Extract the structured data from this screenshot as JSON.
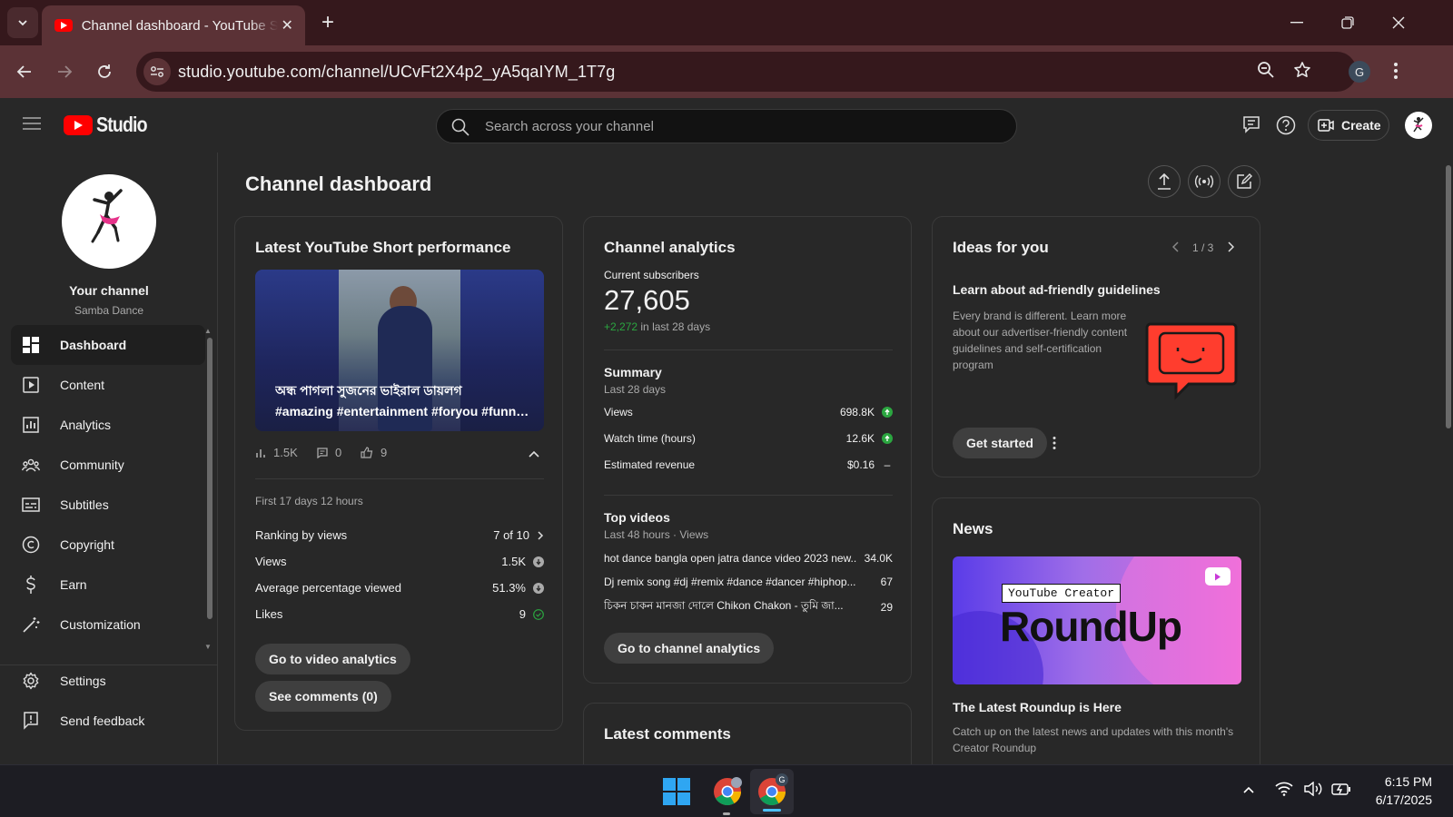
{
  "browser": {
    "tab_title": "Channel dashboard - YouTube Studio",
    "url": "studio.youtube.com/channel/UCvFt2X4p2_yA5qaIYM_1T7g",
    "profile_initial": "G"
  },
  "header": {
    "logo_text": "Studio",
    "search_placeholder": "Search across your channel",
    "create_label": "Create"
  },
  "sidebar": {
    "channel_label": "Your channel",
    "channel_name": "Samba Dance",
    "items": [
      {
        "label": "Dashboard",
        "icon": "dashboard-icon",
        "active": true
      },
      {
        "label": "Content",
        "icon": "content-icon"
      },
      {
        "label": "Analytics",
        "icon": "analytics-icon"
      },
      {
        "label": "Community",
        "icon": "community-icon"
      },
      {
        "label": "Subtitles",
        "icon": "subtitles-icon"
      },
      {
        "label": "Copyright",
        "icon": "copyright-icon"
      },
      {
        "label": "Earn",
        "icon": "earn-icon"
      },
      {
        "label": "Customization",
        "icon": "customization-icon"
      }
    ],
    "bottom_items": [
      {
        "label": "Settings",
        "icon": "gear-icon"
      },
      {
        "label": "Send feedback",
        "icon": "feedback-icon"
      }
    ]
  },
  "main": {
    "title": "Channel dashboard"
  },
  "short_card": {
    "title": "Latest YouTube Short performance",
    "video_title_line1": "অন্ধ পাগলা সুজনের ভাইরাল ডায়লগ",
    "video_title_line2": "#amazing #entertainment #foryou #funny #viral",
    "views_inline": "1.5K",
    "comments_inline": "0",
    "likes_inline": "9",
    "period": "First 17 days 12 hours",
    "stats": [
      {
        "label": "Ranking by views",
        "value": "7 of 10"
      },
      {
        "label": "Views",
        "value": "1.5K"
      },
      {
        "label": "Average percentage viewed",
        "value": "51.3%"
      },
      {
        "label": "Likes",
        "value": "9"
      }
    ],
    "btn_analytics": "Go to video analytics",
    "btn_comments": "See comments (0)"
  },
  "analytics_card": {
    "title": "Channel analytics",
    "subs_label": "Current subscribers",
    "subs_value": "27,605",
    "subs_change": "+2,272",
    "subs_change_suffix": "in last 28 days",
    "summary_title": "Summary",
    "summary_period": "Last 28 days",
    "summary": [
      {
        "label": "Views",
        "value": "698.8K"
      },
      {
        "label": "Watch time (hours)",
        "value": "12.6K"
      },
      {
        "label": "Estimated revenue",
        "value": "$0.16"
      }
    ],
    "top_title": "Top videos",
    "top_period": "Last 48 hours · Views",
    "top_videos": [
      {
        "title": "hot dance bangla open jatra dance video 2023 new...",
        "views": "34.0K"
      },
      {
        "title": "Dj remix song #dj #remix #dance #dancer #hiphop...",
        "views": "67"
      },
      {
        "title": "চিকন চাকন মানজা দোলে Chikon Chakon - তুমি জা...",
        "views": "29"
      }
    ],
    "btn": "Go to channel analytics"
  },
  "ideas_card": {
    "title": "Ideas for you",
    "pager": "1 / 3",
    "idea_title": "Learn about ad-friendly guidelines",
    "idea_body": "Every brand is different. Learn more about our advertiser-friendly content guidelines and self-certification program",
    "btn": "Get started"
  },
  "news_card": {
    "title": "News",
    "banner_tag": "YouTube Creator",
    "banner_title": "RoundUp",
    "headline": "The Latest Roundup is Here",
    "body": "Catch up on the latest news and updates with this month's Creator Roundup"
  },
  "comments_card": {
    "title": "Latest comments"
  },
  "taskbar": {
    "time": "6:15 PM",
    "date": "6/17/2025",
    "chrome_badge": "G"
  },
  "colors": {
    "accent_red": "#ff0000",
    "positive_green": "#2ba640",
    "tab_bar": "#35181c",
    "address_bar": "#5b3236"
  }
}
